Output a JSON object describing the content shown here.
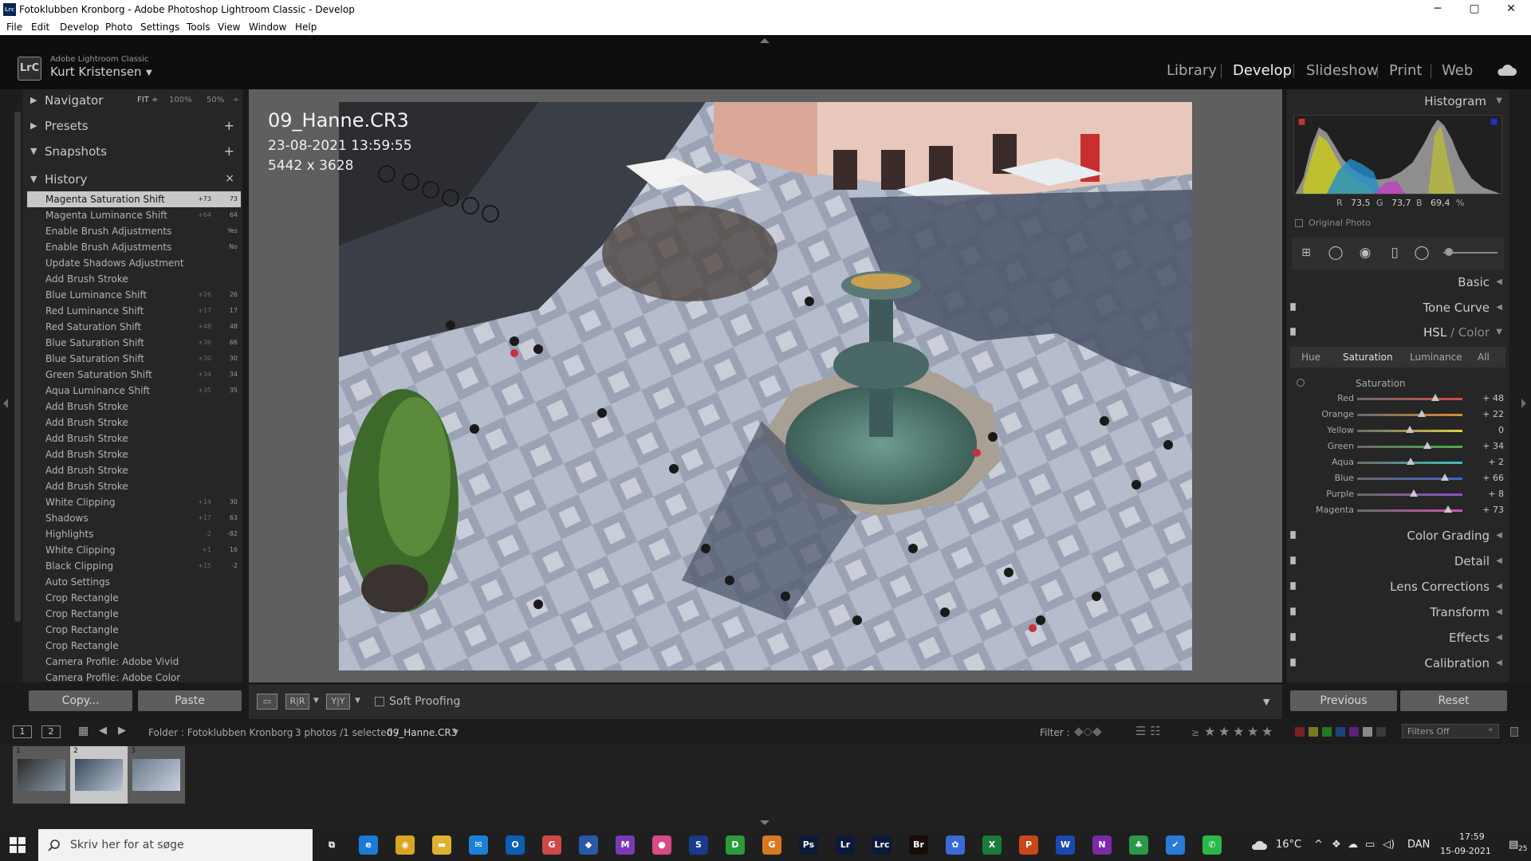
{
  "window": {
    "title": "Fotoklubben Kronborg - Adobe Photoshop Lightroom Classic - Develop",
    "app_icon": "Lrc",
    "min": "─",
    "max": "▢",
    "close": "✕"
  },
  "menu": [
    "File",
    "Edit",
    "Develop",
    "Photo",
    "Settings",
    "Tools",
    "View",
    "Window",
    "Help"
  ],
  "identity": {
    "small": "Adobe Lightroom Classic",
    "name": "Kurt Kristensen",
    "logo": "LrC"
  },
  "modules": [
    "Library",
    "Develop",
    "Slideshow",
    "Print",
    "Web"
  ],
  "active_module": "Develop",
  "left": {
    "navigator": {
      "label": "Navigator",
      "opts": [
        "FIT ÷",
        "100%",
        "50%",
        "÷"
      ]
    },
    "presets": {
      "label": "Presets",
      "action": "+"
    },
    "snapshots": {
      "label": "Snapshots",
      "action": "+"
    },
    "history": {
      "label": "History",
      "action": "×"
    },
    "history_items": [
      {
        "label": "Magenta Saturation Shift",
        "before": "+73",
        "after": "73"
      },
      {
        "label": "Magenta Luminance Shift",
        "before": "+64",
        "after": "64"
      },
      {
        "label": "Enable Brush Adjustments",
        "before": "",
        "after": "Yes"
      },
      {
        "label": "Enable Brush Adjustments",
        "before": "",
        "after": "No"
      },
      {
        "label": "Update Shadows Adjustment",
        "before": "",
        "after": ""
      },
      {
        "label": "Add Brush Stroke",
        "before": "",
        "after": ""
      },
      {
        "label": "Blue Luminance Shift",
        "before": "+26",
        "after": "26"
      },
      {
        "label": "Red Luminance Shift",
        "before": "+17",
        "after": "17"
      },
      {
        "label": "Red Saturation Shift",
        "before": "+48",
        "after": "48"
      },
      {
        "label": "Blue Saturation Shift",
        "before": "+36",
        "after": "66"
      },
      {
        "label": "Blue Saturation Shift",
        "before": "+30",
        "after": "30"
      },
      {
        "label": "Green Saturation Shift",
        "before": "+34",
        "after": "34"
      },
      {
        "label": "Aqua Luminance Shift",
        "before": "+35",
        "after": "35"
      },
      {
        "label": "Add Brush Stroke",
        "before": "",
        "after": ""
      },
      {
        "label": "Add Brush Stroke",
        "before": "",
        "after": ""
      },
      {
        "label": "Add Brush Stroke",
        "before": "",
        "after": ""
      },
      {
        "label": "Add Brush Stroke",
        "before": "",
        "after": ""
      },
      {
        "label": "Add Brush Stroke",
        "before": "",
        "after": ""
      },
      {
        "label": "Add Brush Stroke",
        "before": "",
        "after": ""
      },
      {
        "label": "White Clipping",
        "before": "+14",
        "after": "30"
      },
      {
        "label": "Shadows",
        "before": "+17",
        "after": "63"
      },
      {
        "label": "Highlights",
        "before": "-2",
        "after": "-82"
      },
      {
        "label": "White Clipping",
        "before": "+1",
        "after": "16"
      },
      {
        "label": "Black Clipping",
        "before": "+15",
        "after": "-2"
      },
      {
        "label": "Auto Settings",
        "before": "",
        "after": ""
      },
      {
        "label": "Crop Rectangle",
        "before": "",
        "after": ""
      },
      {
        "label": "Crop Rectangle",
        "before": "",
        "after": ""
      },
      {
        "label": "Crop Rectangle",
        "before": "",
        "after": ""
      },
      {
        "label": "Crop Rectangle",
        "before": "",
        "after": ""
      },
      {
        "label": "Camera Profile: Adobe Vivid",
        "before": "",
        "after": ""
      },
      {
        "label": "Camera Profile: Adobe Color",
        "before": "",
        "after": ""
      }
    ],
    "copy": "Copy...",
    "paste": "Paste"
  },
  "photo": {
    "filename": "09_Hanne.CR3",
    "datetime": "23-08-2021 13:59:55",
    "dimensions": "5442 x 3628"
  },
  "toolbar": {
    "soft_proofing": "Soft Proofing",
    "view_before_after": "R|R",
    "view_yy": "Y|Y"
  },
  "right": {
    "histogram": {
      "label": "Histogram",
      "r_label": "R",
      "r": "73,5",
      "g_label": "G",
      "g": "73,7",
      "b_label": "B",
      "b": "69,4",
      "pct": "%",
      "original": "Original Photo"
    },
    "panels_top": [
      "Basic",
      "Tone Curve"
    ],
    "hsl_label": "HSL",
    "color_label": "Color",
    "hsl_sep": "/",
    "tabs": [
      "Hue",
      "Saturation",
      "Luminance",
      "All"
    ],
    "active_tab": "Saturation",
    "section": "Saturation",
    "sliders": [
      {
        "label": "Red",
        "value": 48,
        "text": "+ 48",
        "color": "#d24a4a"
      },
      {
        "label": "Orange",
        "value": 22,
        "text": "+ 22",
        "color": "#e08a30"
      },
      {
        "label": "Yellow",
        "value": 0,
        "text": "0",
        "color": "#e0d040"
      },
      {
        "label": "Green",
        "value": 34,
        "text": "+ 34",
        "color": "#48b048"
      },
      {
        "label": "Aqua",
        "value": 2,
        "text": "+ 2",
        "color": "#40c0c0"
      },
      {
        "label": "Blue",
        "value": 66,
        "text": "+ 66",
        "color": "#4060d0"
      },
      {
        "label": "Purple",
        "value": 8,
        "text": "+ 8",
        "color": "#9050c8"
      },
      {
        "label": "Magenta",
        "value": 73,
        "text": "+ 73",
        "color": "#d050b0"
      }
    ],
    "panels_bottom": [
      "Color Grading",
      "Detail",
      "Lens Corrections",
      "Transform",
      "Effects",
      "Calibration"
    ],
    "previous": "Previous",
    "reset": "Reset"
  },
  "filmbar": {
    "num1": "1",
    "num2": "2",
    "folder": "Folder : Fotoklubben Kronborg",
    "count": "3 photos /1 selected /",
    "selected_file": "09_Hanne.CR3",
    "filter": "Filter :",
    "filters_off": "Filters Off",
    "stars_prefix": "≥"
  },
  "thumbs": [
    {
      "num": "1"
    },
    {
      "num": "2"
    },
    {
      "num": "3"
    }
  ],
  "taskbar": {
    "search": "Skriv her for at søge",
    "temp": "16°C",
    "lang": "DAN",
    "time": "17:59",
    "date": "15-09-2021",
    "notif": "25",
    "apps": [
      {
        "name": "task-view",
        "label": "⧉",
        "color": "#1f1f1f"
      },
      {
        "name": "edge",
        "label": "e",
        "color": "#1a7ad8"
      },
      {
        "name": "chrome",
        "label": "◉",
        "color": "#d9a520"
      },
      {
        "name": "explorer",
        "label": "▬",
        "color": "#e0b030"
      },
      {
        "name": "mail",
        "label": "✉",
        "color": "#1a80d8"
      },
      {
        "name": "outlook",
        "label": "O",
        "color": "#0a5fb0"
      },
      {
        "name": "app-red",
        "label": "G",
        "color": "#d04848"
      },
      {
        "name": "cube",
        "label": "◆",
        "color": "#2858a8"
      },
      {
        "name": "app-purple",
        "label": "M",
        "color": "#7a3ab8"
      },
      {
        "name": "app-pink",
        "label": "●",
        "color": "#d84a8a"
      },
      {
        "name": "app-s",
        "label": "S",
        "color": "#1a3a8a"
      },
      {
        "name": "app-d",
        "label": "D",
        "color": "#2a9a3a"
      },
      {
        "name": "app-g",
        "label": "G",
        "color": "#d87820"
      },
      {
        "name": "photoshop",
        "label": "Ps",
        "color": "#0a1a3a"
      },
      {
        "name": "lightroom",
        "label": "Lr",
        "color": "#0a1a3a"
      },
      {
        "name": "lrc",
        "label": "Lrc",
        "color": "#0a1a3a"
      },
      {
        "name": "bridge",
        "label": "Br",
        "color": "#1a0a0a"
      },
      {
        "name": "app-multi",
        "label": "✿",
        "color": "#3a6ad8"
      },
      {
        "name": "excel",
        "label": "X",
        "color": "#1a7a3a"
      },
      {
        "name": "powerpoint",
        "label": "P",
        "color": "#c8481a"
      },
      {
        "name": "word",
        "label": "W",
        "color": "#1a4ab0"
      },
      {
        "name": "onenote",
        "label": "N",
        "color": "#7a2aa8"
      },
      {
        "name": "app-green",
        "label": "♣",
        "color": "#2a9a4a"
      },
      {
        "name": "todo",
        "label": "✔",
        "color": "#2a7ad8"
      },
      {
        "name": "whatsapp",
        "label": "✆",
        "color": "#2ab84a"
      }
    ]
  }
}
